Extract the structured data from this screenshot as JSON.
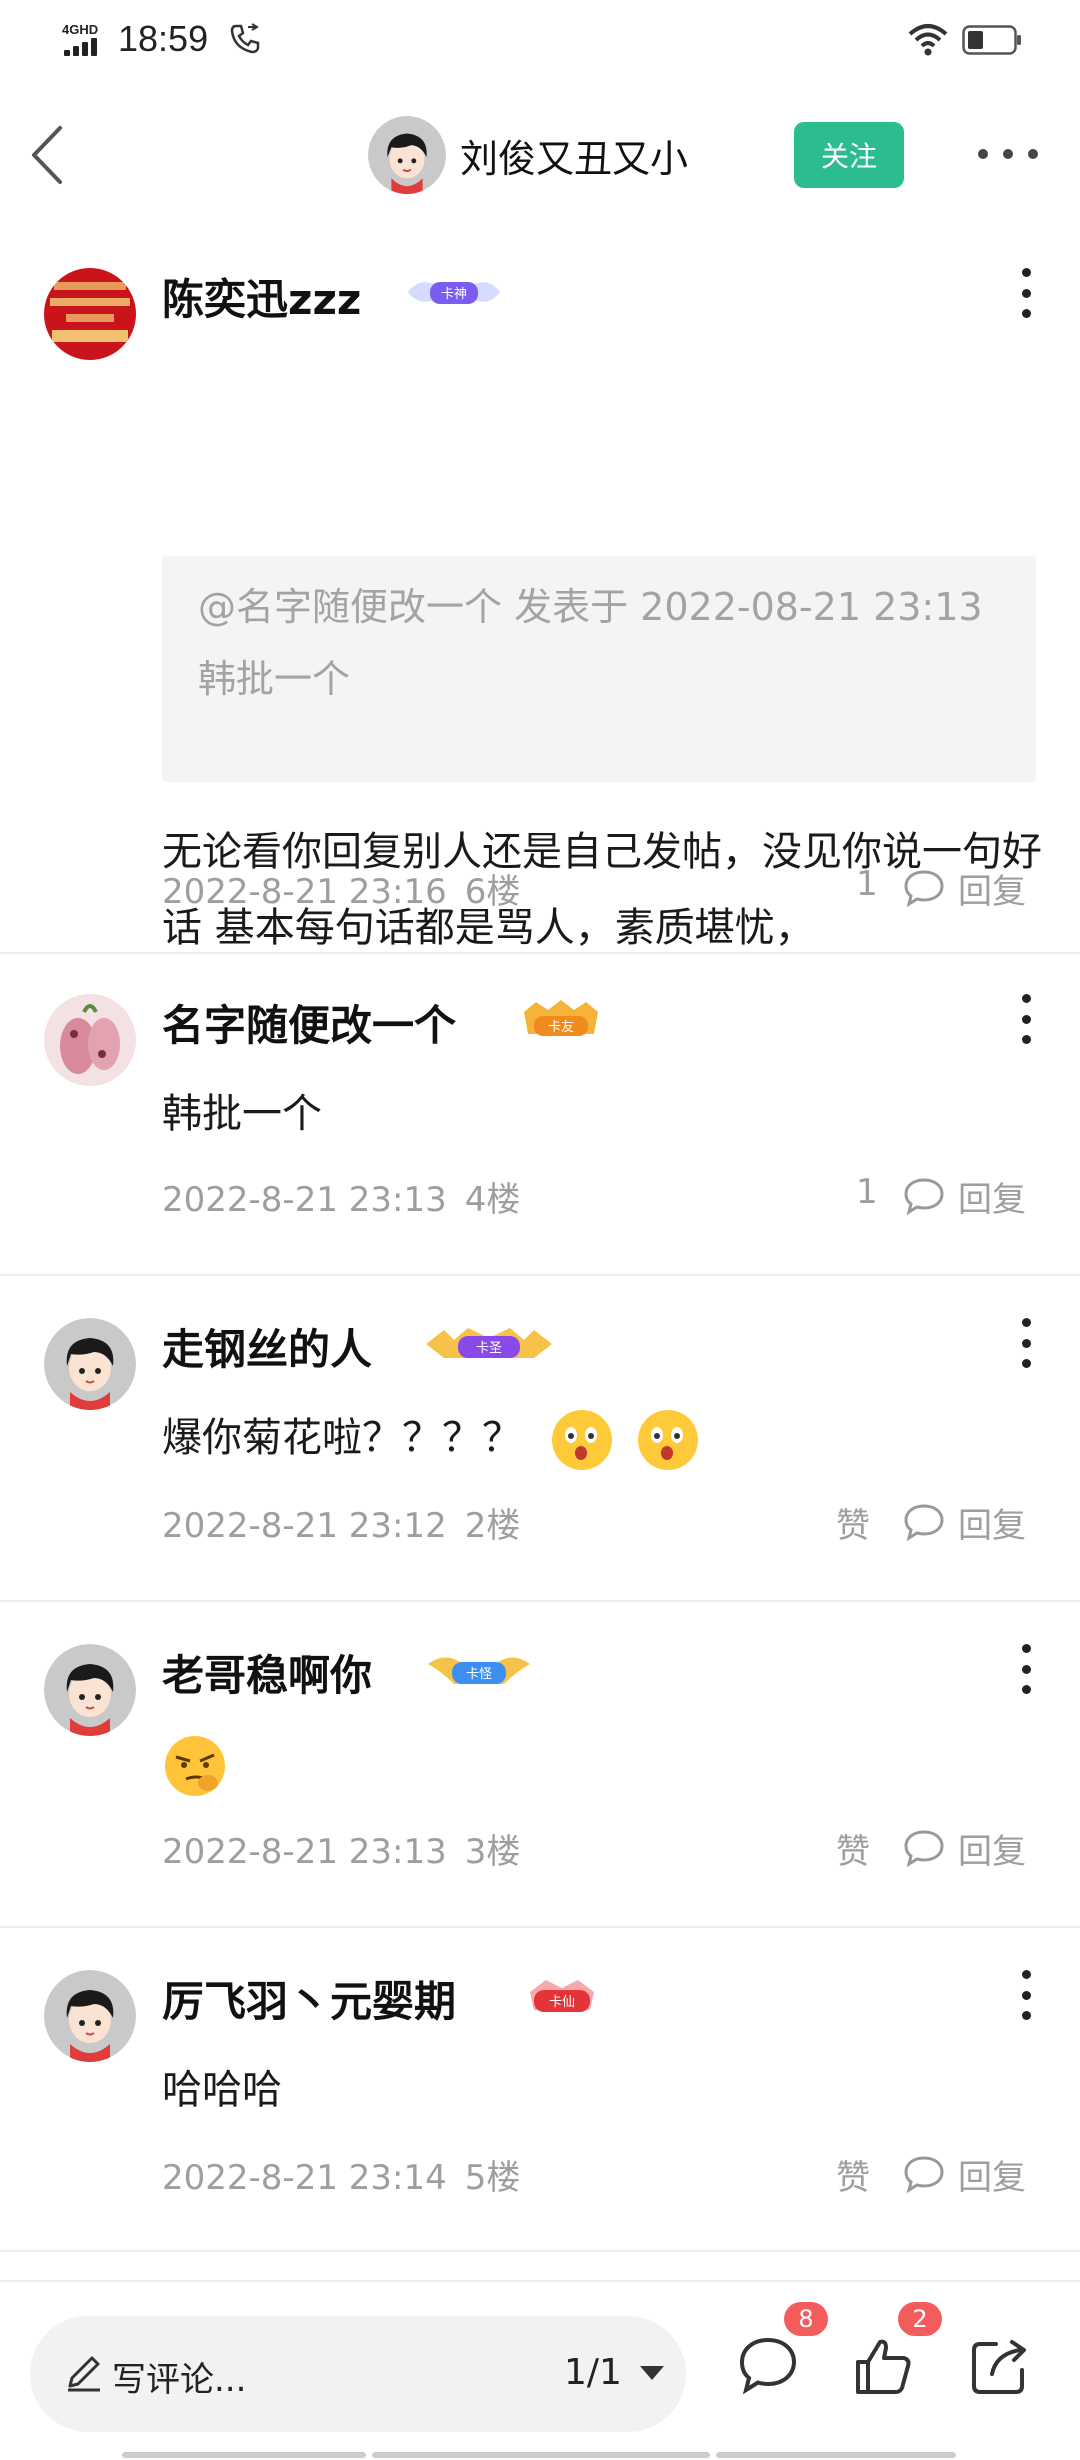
{
  "status_bar": {
    "network": "4GHD",
    "time": "18:59"
  },
  "header": {
    "title": "刘俊又丑又小",
    "follow_label": "关注"
  },
  "comments": [
    {
      "name": "陈奕迅zzz",
      "badge": "卡神",
      "quote": {
        "meta": "@名字随便改一个 发表于 2022-08-21 23:13",
        "body": "韩批一个"
      },
      "text": "无论看你回复别人还是自己发帖，没见你说一句好话 基本每句话都是骂人，素质堪忧，",
      "time": "2022-8-21 23:16",
      "floor": "6楼",
      "likes": "1",
      "reply_label": "回复"
    },
    {
      "name": "名字随便改一个",
      "badge": "卡友",
      "text": "韩批一个",
      "time": "2022-8-21 23:13",
      "floor": "4楼",
      "likes": "1",
      "reply_label": "回复"
    },
    {
      "name": "走钢丝的人",
      "badge": "卡圣",
      "text": "爆你菊花啦？？？？",
      "time": "2022-8-21 23:12",
      "floor": "2楼",
      "likes": "赞",
      "reply_label": "回复"
    },
    {
      "name": "老哥稳啊你",
      "badge": "卡怪",
      "text": "",
      "time": "2022-8-21 23:13",
      "floor": "3楼",
      "likes": "赞",
      "reply_label": "回复"
    },
    {
      "name": "厉飞羽丶元婴期",
      "badge": "卡仙",
      "text": "哈哈哈",
      "time": "2022-8-21 23:14",
      "floor": "5楼",
      "likes": "赞",
      "reply_label": "回复"
    }
  ],
  "bottom_bar": {
    "placeholder": "写评论...",
    "page": "1/1",
    "comments_badge": "8",
    "likes_badge": "2"
  },
  "icons": {
    "back": "chevron-left-icon",
    "more": "more-horizontal-icon",
    "menu": "more-vertical-icon",
    "reply": "speech-bubble-icon",
    "comment": "comment-icon",
    "like": "thumbs-up-icon",
    "share": "share-icon",
    "pencil": "pencil-icon"
  },
  "colors": {
    "accent": "#2bbd8f",
    "badge_red": "#f45b5b",
    "meta_gray": "#9e9e9e"
  }
}
